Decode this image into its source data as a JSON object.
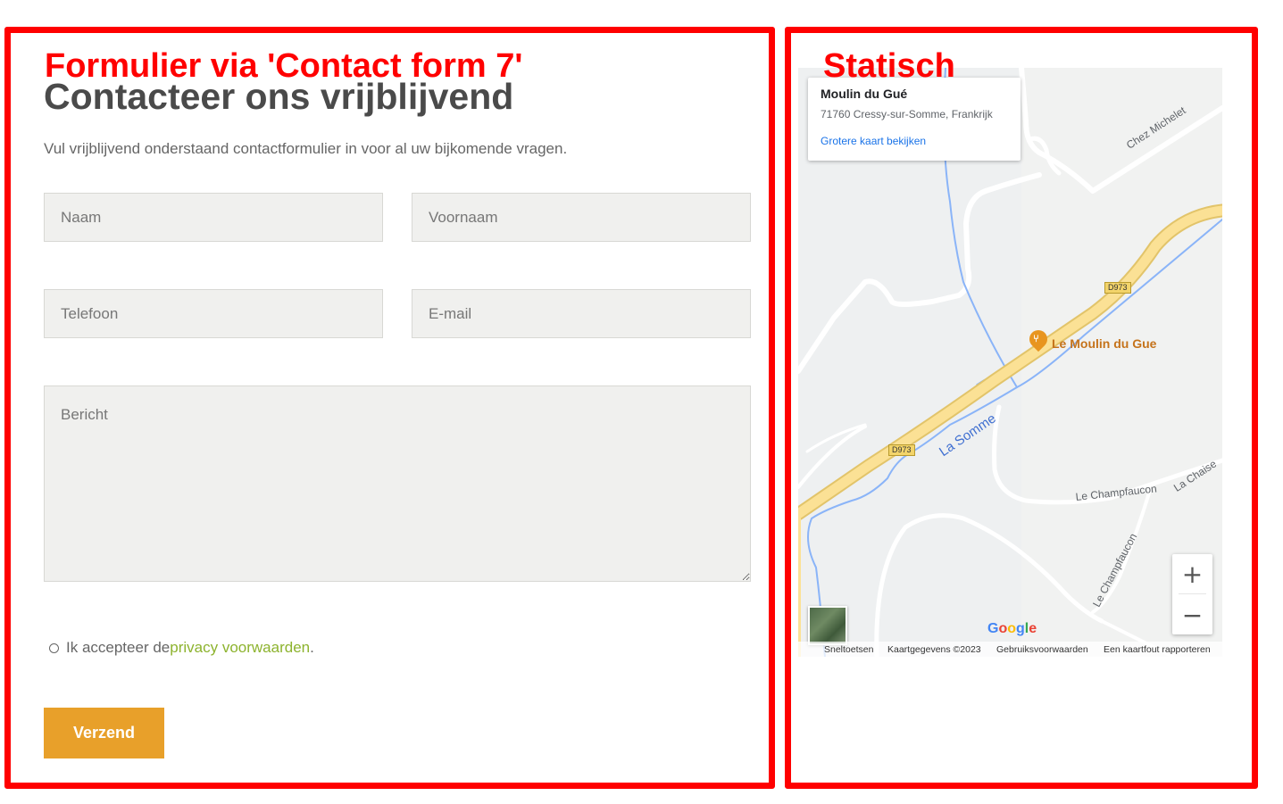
{
  "annotations": {
    "left_panel_label": "Formulier via 'Contact form 7'",
    "right_panel_label": "Statisch",
    "border_color": "#ff0000"
  },
  "form": {
    "title": "Contacteer ons vrijblijvend",
    "intro": "Vul vrijblijvend onderstaand contactformulier in voor al uw bijkomende vragen.",
    "fields": {
      "naam_placeholder": "Naam",
      "voornaam_placeholder": "Voornaam",
      "telefoon_placeholder": "Telefoon",
      "email_placeholder": "E-mail",
      "bericht_placeholder": "Bericht"
    },
    "consent": {
      "prefix": "Ik accepteer de ",
      "link_text": "privacy voorwaarden",
      "suffix": ".",
      "link_color": "#8db32e"
    },
    "submit_label": "Verzend",
    "submit_color": "#e8a02a"
  },
  "map": {
    "card": {
      "title": "Moulin du Gué",
      "address": "71760 Cressy-sur-Somme, Frankrijk",
      "link": "Grotere kaart bekijken"
    },
    "labels": {
      "chez_michelet": "Chez Michelet",
      "la_somme": "La Somme",
      "le_champfaucon_1": "Le Champfaucon",
      "la_chaise": "La Chaise",
      "le_champfaucon_2": "Le Champfaucon",
      "poi": "Le Moulin du Gue",
      "road_1": "D973",
      "road_2": "D973"
    },
    "zoom_in": "+",
    "zoom_out": "−",
    "google": "Google",
    "footer": {
      "shortcuts": "Sneltoetsen",
      "data": "Kaartgegevens ©2023",
      "terms": "Gebruiksvoorwaarden",
      "report": "Een kaartfout rapporteren"
    },
    "icons": {
      "poi": "restaurant-pin-icon",
      "satellite": "satellite-thumbnail-icon"
    }
  }
}
